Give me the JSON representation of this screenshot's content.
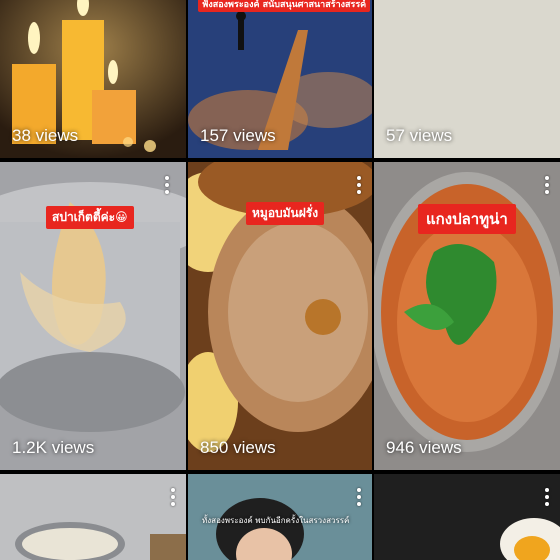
{
  "tiles": [
    {
      "views": "38 views"
    },
    {
      "views": "157 views",
      "caption": "ฟังสองพระองค์ สนับสนุนศาสนาสร้างสรรค์"
    },
    {
      "views": "57 views"
    },
    {
      "views": "1.2K views",
      "caption": "สปาเก็ตตี้ค่ะ😀"
    },
    {
      "views": "850 views",
      "caption": "หมูอบมันฝรั่ง"
    },
    {
      "views": "946 views",
      "caption": "แกงปลาทูน่า"
    },
    {
      "views": ""
    },
    {
      "views": "",
      "caption": "ทั้งสองพระองค์ พบกันอีกครั้งในสรวงสวรรค์"
    },
    {
      "views": ""
    }
  ],
  "icons": {
    "more": "more-vert-icon"
  }
}
